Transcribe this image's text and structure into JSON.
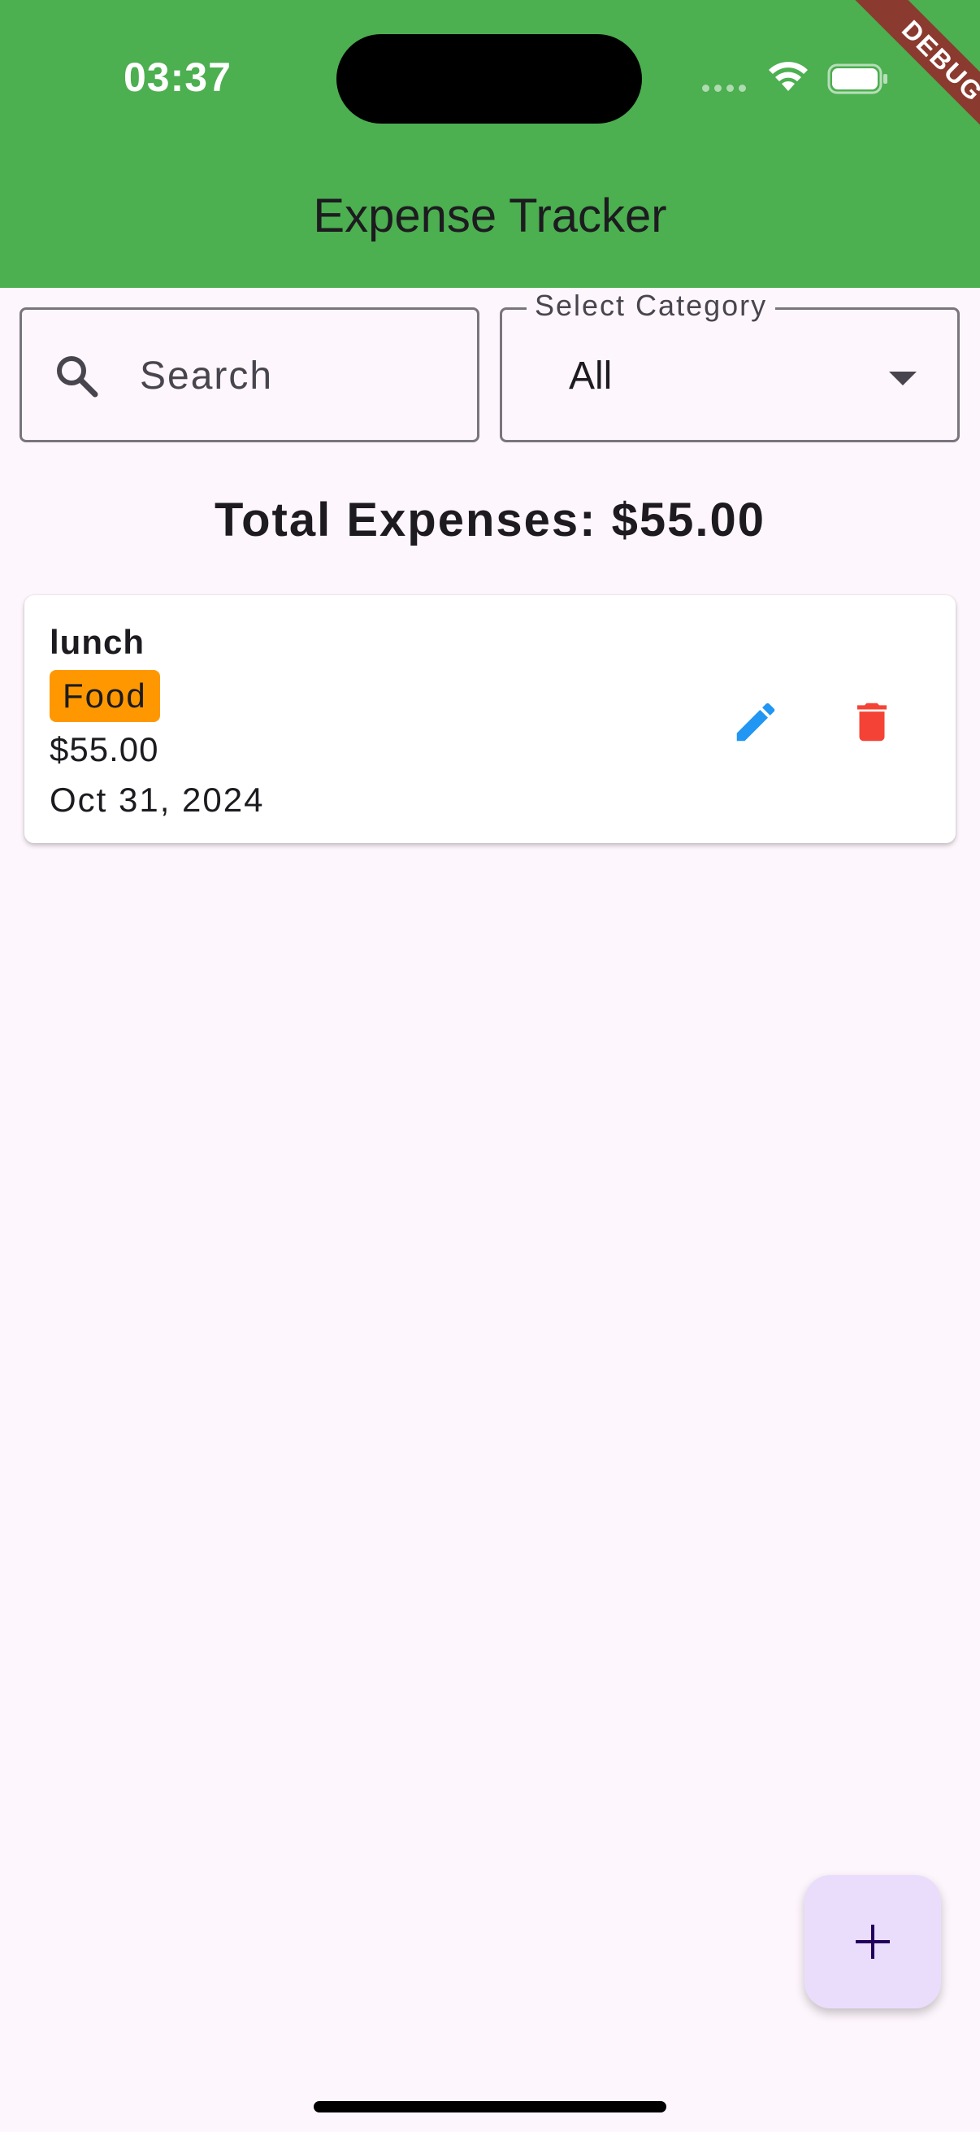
{
  "status_bar": {
    "time": "03:37"
  },
  "debug_banner": "DEBUG",
  "app_bar": {
    "title": "Expense Tracker"
  },
  "search": {
    "placeholder": "Search",
    "icon": "search-icon"
  },
  "category_filter": {
    "label": "Select Category",
    "selected": "All"
  },
  "total": {
    "text": "Total Expenses: $55.00"
  },
  "expenses": [
    {
      "title": "lunch",
      "category": "Food",
      "amount": "$55.00",
      "date": "Oct 31, 2024",
      "category_color": "#ff9800"
    }
  ],
  "colors": {
    "app_bar": "#4caf50",
    "edit": "#2196f3",
    "delete": "#f44336",
    "fab": "#eaddfc",
    "fab_icon": "#21005d"
  },
  "fab": {
    "icon": "add-icon"
  }
}
